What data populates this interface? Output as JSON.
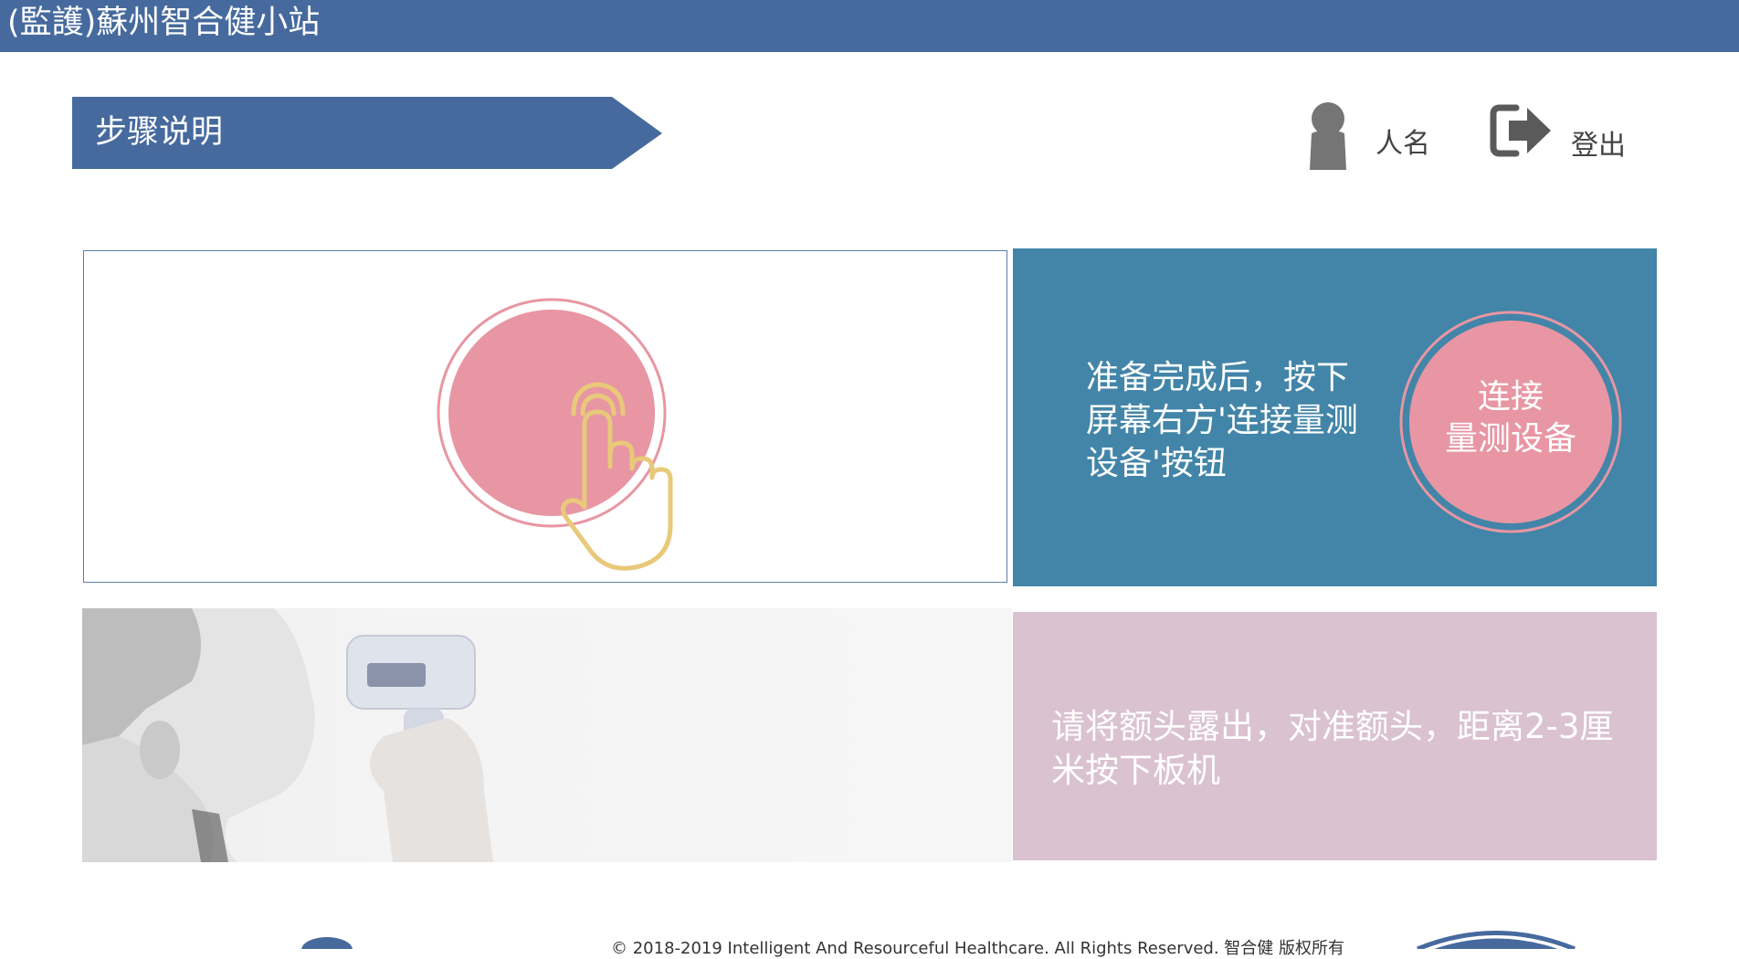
{
  "app": {
    "title": "(監護)蘇州智合健小站"
  },
  "header": {
    "step_banner": "步骤说明",
    "user_name": "人名",
    "logout_label": "登出"
  },
  "step1": {
    "instruction": "准备完成后，按下屏幕右方'连接量测设备'按钮",
    "button_label": "连接\n量测设备"
  },
  "step2": {
    "instruction": "请将额头露出，对准额头，距离2-3厘米按下板机"
  },
  "footer": {
    "copyright": "© 2018-2019 Intelligent And Resourceful Healthcare. All Rights Reserved. 智合健 版权所有"
  },
  "colors": {
    "header_bar": "#466a9e",
    "step_banner": "#466a9e",
    "instruction_panel": "#4285a8",
    "pink_circle": "#e896a3",
    "hand_outline": "#e8c97a",
    "measure_panel": "#dac2d0"
  },
  "icons": [
    "user-icon",
    "logout-icon",
    "hand-pointer-icon"
  ]
}
